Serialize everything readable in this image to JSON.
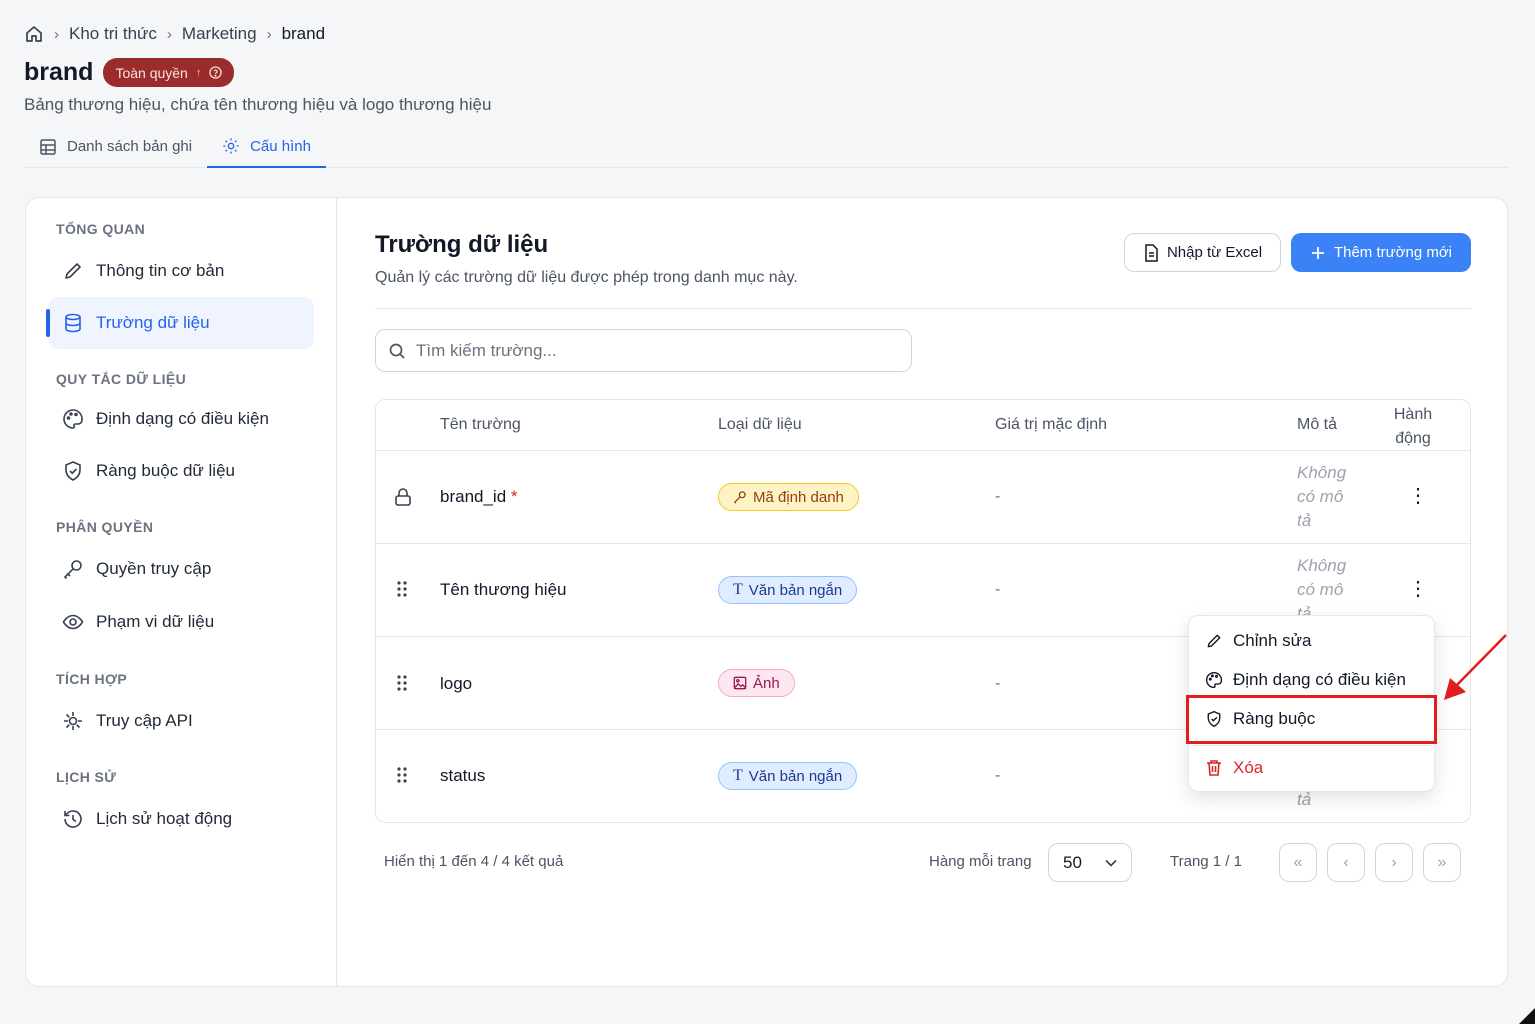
{
  "breadcrumb": {
    "home_icon": "home-icon",
    "items": [
      "Kho tri thức",
      "Marketing",
      "brand"
    ]
  },
  "header": {
    "title": "brand",
    "badge": "Toàn quyền",
    "subtitle": "Bảng thương hiệu, chứa tên thương hiệu và logo thương hiệu"
  },
  "tabs": [
    {
      "label": "Danh sách bản ghi",
      "icon": "table-icon"
    },
    {
      "label": "Cấu hình",
      "icon": "gear-icon",
      "active": true
    }
  ],
  "sidebar": {
    "sections": [
      {
        "title": "TỔNG QUAN",
        "items": [
          {
            "label": "Thông tin cơ bản",
            "icon": "pencil-icon"
          },
          {
            "label": "Trường dữ liệu",
            "icon": "database-icon",
            "active": true
          }
        ]
      },
      {
        "title": "QUY TẮC DỮ LIỆU",
        "items": [
          {
            "label": "Định dạng có điều kiện",
            "icon": "palette-icon"
          },
          {
            "label": "Ràng buộc dữ liệu",
            "icon": "shield-icon"
          }
        ]
      },
      {
        "title": "PHÂN QUYỀN",
        "items": [
          {
            "label": "Quyền truy cập",
            "icon": "key-icon"
          },
          {
            "label": "Phạm vi dữ liệu",
            "icon": "eye-icon"
          }
        ]
      },
      {
        "title": "TÍCH HỢP",
        "items": [
          {
            "label": "Truy cập API",
            "icon": "api-icon"
          }
        ]
      },
      {
        "title": "LỊCH SỬ",
        "items": [
          {
            "label": "Lịch sử hoạt động",
            "icon": "history-icon"
          }
        ]
      }
    ]
  },
  "main": {
    "title": "Trường dữ liệu",
    "description": "Quản lý các trường dữ liệu được phép trong danh mục này.",
    "import_label": "Nhập từ Excel",
    "add_label": "Thêm trường mới",
    "search_placeholder": "Tìm kiếm trường..."
  },
  "table": {
    "columns": [
      "Tên trường",
      "Loại dữ liệu",
      "Giá trị mặc định",
      "Mô tả",
      "Hành động"
    ],
    "rows": [
      {
        "name": "brand_id",
        "required": true,
        "locked": true,
        "type": "Mã định danh",
        "type_kind": "id",
        "default": "-",
        "description": "Không có mô tả"
      },
      {
        "name": "Tên thương hiệu",
        "required": false,
        "locked": false,
        "type": "Văn bản ngắn",
        "type_kind": "text",
        "default": "-",
        "description": "Không có mô tả"
      },
      {
        "name": "logo",
        "required": false,
        "locked": false,
        "type": "Ảnh",
        "type_kind": "image",
        "default": "-",
        "description": ""
      },
      {
        "name": "status",
        "required": false,
        "locked": false,
        "type": "Văn bản ngắn",
        "type_kind": "text",
        "default": "-",
        "description": "tả"
      }
    ]
  },
  "pagination": {
    "summary": "Hiển thị 1 đến 4 / 4 kết quả",
    "per_page_label": "Hàng mỗi trang",
    "per_page_value": "50",
    "page_label": "Trang 1 / 1"
  },
  "context_menu": {
    "items": [
      {
        "label": "Chỉnh sửa",
        "icon": "pencil-icon"
      },
      {
        "label": "Định dạng có điều kiện",
        "icon": "palette-icon"
      },
      {
        "label": "Ràng buộc",
        "icon": "shield-icon",
        "highlighted": true
      },
      {
        "label": "Xóa",
        "icon": "trash-icon",
        "danger": true
      }
    ]
  },
  "colors": {
    "accent": "#3b82f6",
    "badge": "#9b2c2c",
    "danger": "#dc2626",
    "annotation": "#e11d1d"
  }
}
